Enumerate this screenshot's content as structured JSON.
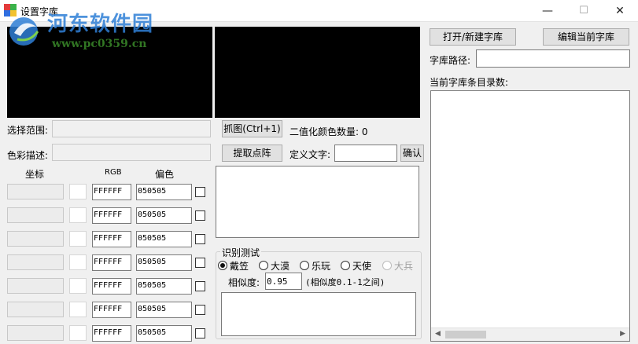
{
  "window": {
    "title": "设置字库",
    "minimize_glyph": "—",
    "maximize_glyph": "☐",
    "close_glyph": "✕"
  },
  "watermark": {
    "name": "河东软件园",
    "url": "www.pc0359.cn"
  },
  "left": {
    "select_range_label": "选择范围:",
    "color_desc_label": "色彩描述:",
    "coord_header": "坐标",
    "rgb_header": "RGB",
    "offset_header": "偏色",
    "rows": [
      {
        "rgb": "FFFFFF",
        "offset": "050505"
      },
      {
        "rgb": "FFFFFF",
        "offset": "050505"
      },
      {
        "rgb": "FFFFFF",
        "offset": "050505"
      },
      {
        "rgb": "FFFFFF",
        "offset": "050505"
      },
      {
        "rgb": "FFFFFF",
        "offset": "050505"
      },
      {
        "rgb": "FFFFFF",
        "offset": "050505"
      },
      {
        "rgb": "FFFFFF",
        "offset": "050505"
      }
    ]
  },
  "middle": {
    "capture_button": "抓图(Ctrl+1)",
    "binary_color_count_label": "二值化颜色数量: 0",
    "extract_button": "提取点阵",
    "define_text_label": "定义文字:",
    "define_text_value": "",
    "confirm_button": "确认",
    "recognize_group_title": "识别测试",
    "radios": [
      {
        "label": "戴笠",
        "selected": true,
        "disabled": false
      },
      {
        "label": "大漠",
        "selected": false,
        "disabled": false
      },
      {
        "label": "乐玩",
        "selected": false,
        "disabled": false
      },
      {
        "label": "天使",
        "selected": false,
        "disabled": false
      },
      {
        "label": "大兵",
        "selected": false,
        "disabled": true
      }
    ],
    "similarity_label": "相似度:",
    "similarity_value": "0.95",
    "similarity_hint": "(相似度0.1-1之间)"
  },
  "right": {
    "open_new_button": "打开/新建字库",
    "edit_current_button": "编辑当前字库",
    "path_label": "字库路径:",
    "path_value": "",
    "entries_label": "当前字库条目录数:"
  },
  "colors": {
    "watermark_blue": "#2f7fd6",
    "watermark_green": "#3a8a2a",
    "panel_black": "#000000"
  }
}
